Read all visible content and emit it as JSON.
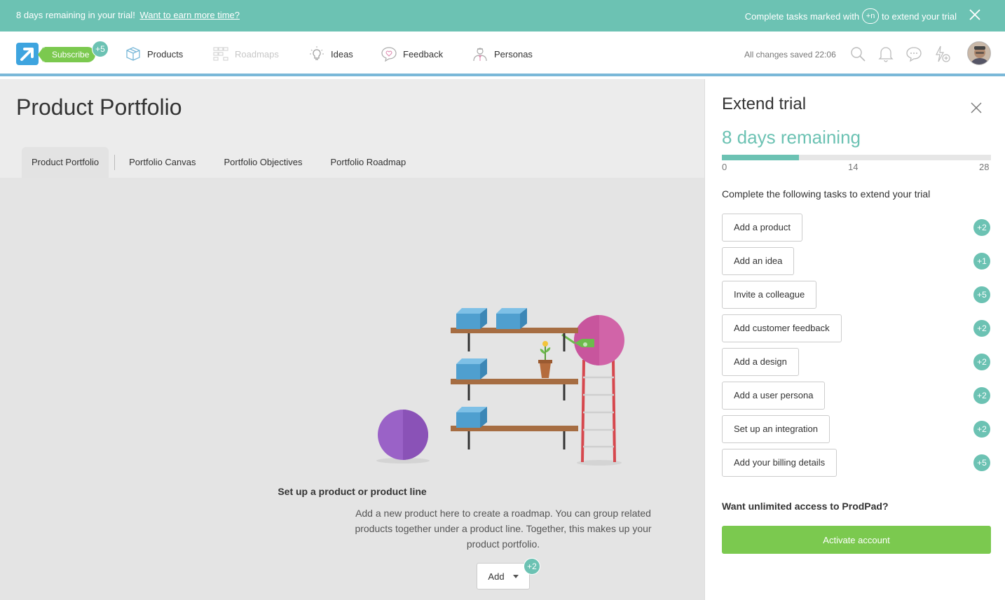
{
  "banner": {
    "trial_text": "8 days remaining in your trial!",
    "trial_link": "Want to earn more time?",
    "tasks_prefix": "Complete tasks marked with",
    "tasks_pill": "+n",
    "tasks_suffix": "to extend your trial",
    "close_icon": "close-icon"
  },
  "nav": {
    "subscribe_label": "Subscribe",
    "subscribe_badge": "+5",
    "items": [
      {
        "label": "Products",
        "icon": "box-icon",
        "enabled": true
      },
      {
        "label": "Roadmaps",
        "icon": "grid-icon",
        "enabled": false
      },
      {
        "label": "Ideas",
        "icon": "lightbulb-icon",
        "enabled": true
      },
      {
        "label": "Feedback",
        "icon": "heart-chat-icon",
        "enabled": true
      },
      {
        "label": "Personas",
        "icon": "persona-icon",
        "enabled": true
      }
    ],
    "saved_status": "All changes saved 22:06",
    "right_icons": [
      "search-icon",
      "bell-icon",
      "chat-icon",
      "lightning-plus-icon",
      "avatar"
    ]
  },
  "main": {
    "title": "Product Portfolio",
    "tabs": [
      {
        "label": "Product Portfolio",
        "active": true
      },
      {
        "label": "Portfolio Canvas",
        "active": false
      },
      {
        "label": "Portfolio Objectives",
        "active": false
      },
      {
        "label": "Portfolio Roadmap",
        "active": false
      }
    ],
    "empty_title": "Set up a product or product line",
    "empty_desc": "Add a new product here to create a roadmap. You can group related products together under a product line. Together, this makes up your product portfolio.",
    "add_label": "Add",
    "add_badge": "+2"
  },
  "panel": {
    "title": "Extend trial",
    "remaining": "8 days remaining",
    "progress": {
      "value": 8,
      "max": 28,
      "ticks": [
        "0",
        "14",
        "28"
      ]
    },
    "instructions": "Complete the following tasks to extend your trial",
    "tasks": [
      {
        "label": "Add a product",
        "badge": "+2"
      },
      {
        "label": "Add an idea",
        "badge": "+1"
      },
      {
        "label": "Invite a colleague",
        "badge": "+5"
      },
      {
        "label": "Add customer feedback",
        "badge": "+2"
      },
      {
        "label": "Add a design",
        "badge": "+2"
      },
      {
        "label": "Add a user persona",
        "badge": "+2"
      },
      {
        "label": "Set up an integration",
        "badge": "+2"
      },
      {
        "label": "Add your billing details",
        "badge": "+5"
      }
    ],
    "unlimited": "Want unlimited access to ProdPad?",
    "activate_label": "Activate account"
  },
  "colors": {
    "teal": "#6cc2b3",
    "green": "#7bc94f",
    "nav_accent": "#7ab8d8"
  }
}
